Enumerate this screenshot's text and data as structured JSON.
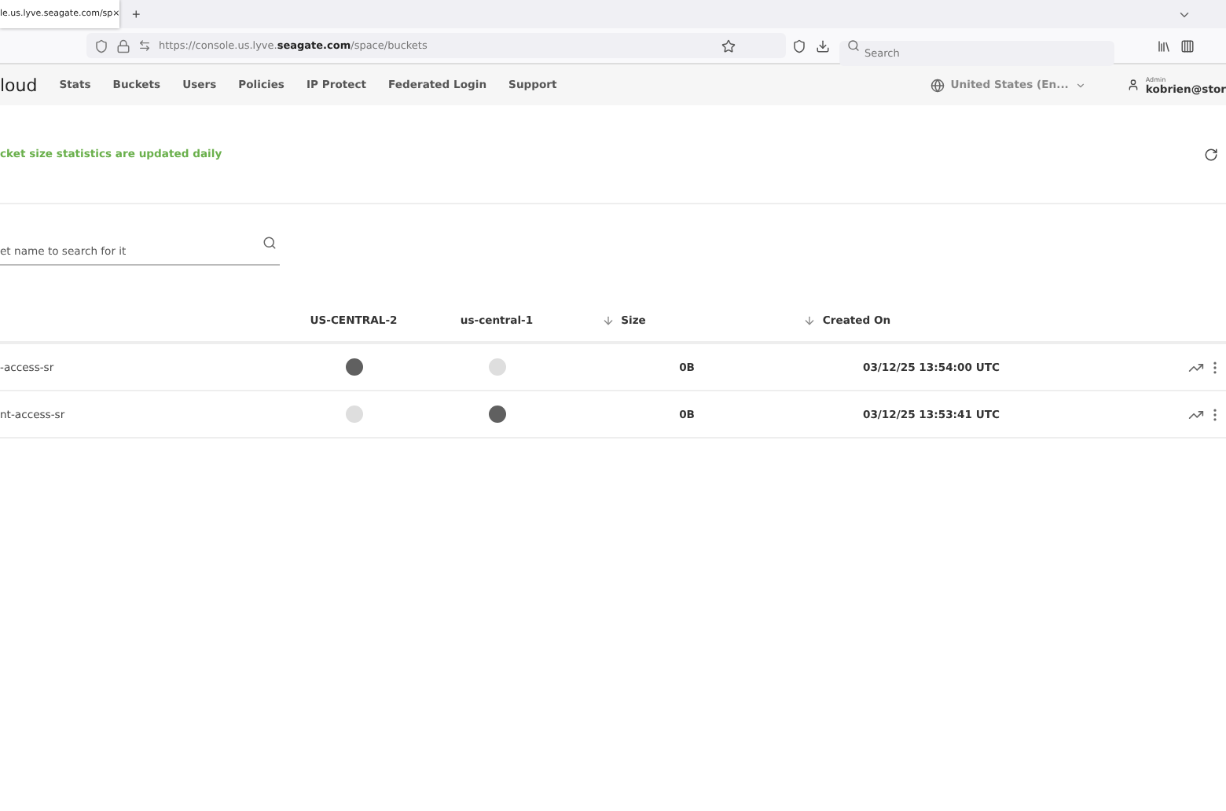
{
  "browser": {
    "tab_title": "le.us.lyve.seagate.com/sp",
    "tab_close": "×",
    "new_tab": "+",
    "url_prefix": "https://console.us.lyve.",
    "url_domain": "seagate.com",
    "url_path": "/space/buckets",
    "search_placeholder": "Search"
  },
  "app_nav": {
    "logo": "loud",
    "items": [
      "Stats",
      "Buckets",
      "Users",
      "Policies",
      "IP Protect",
      "Federated Login",
      "Support"
    ],
    "region": "United States (En...",
    "user_role": "Admin",
    "user_email": "kobrien@stor"
  },
  "notice": "cket size statistics are updated daily",
  "search": {
    "placeholder": "et name to search for it"
  },
  "table": {
    "columns": [
      {
        "label": "US-CENTRAL-2",
        "sortable": false
      },
      {
        "label": "us-central-1",
        "sortable": false
      },
      {
        "label": "Size",
        "sortable": true
      },
      {
        "label": "Created On",
        "sortable": true
      }
    ],
    "rows": [
      {
        "name": "-access-sr",
        "regions": [
          {
            "on": true
          },
          {
            "on": false
          }
        ],
        "size": "0B",
        "created": "03/12/25 13:54:00 UTC"
      },
      {
        "name": "nt-access-sr",
        "regions": [
          {
            "on": false
          },
          {
            "on": true
          }
        ],
        "size": "0B",
        "created": "03/12/25 13:53:41 UTC"
      }
    ]
  }
}
